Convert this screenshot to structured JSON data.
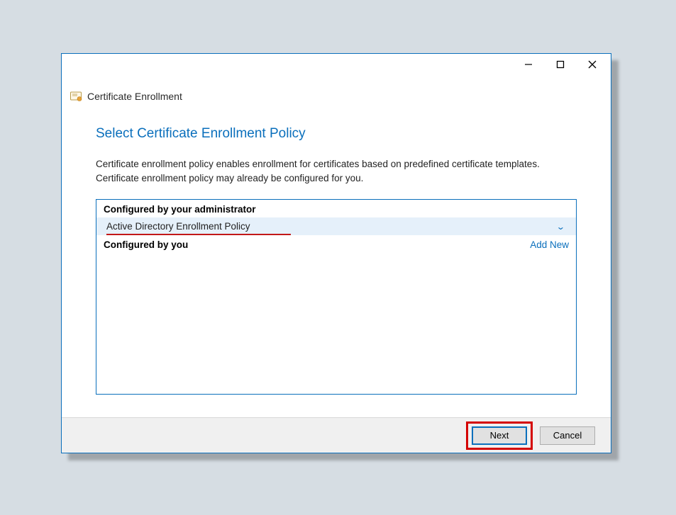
{
  "window": {
    "title": "Certificate Enrollment"
  },
  "page": {
    "heading": "Select Certificate Enrollment Policy",
    "description": "Certificate enrollment policy enables enrollment for certificates based on predefined certificate templates. Certificate enrollment policy may already be configured for you."
  },
  "sections": {
    "admin": {
      "label": "Configured by your administrator",
      "policy": "Active Directory Enrollment Policy"
    },
    "user": {
      "label": "Configured by you",
      "add_new": "Add New"
    }
  },
  "buttons": {
    "next": "Next",
    "cancel": "Cancel"
  },
  "colors": {
    "accent": "#0a6fbc",
    "highlight": "#d40000"
  }
}
